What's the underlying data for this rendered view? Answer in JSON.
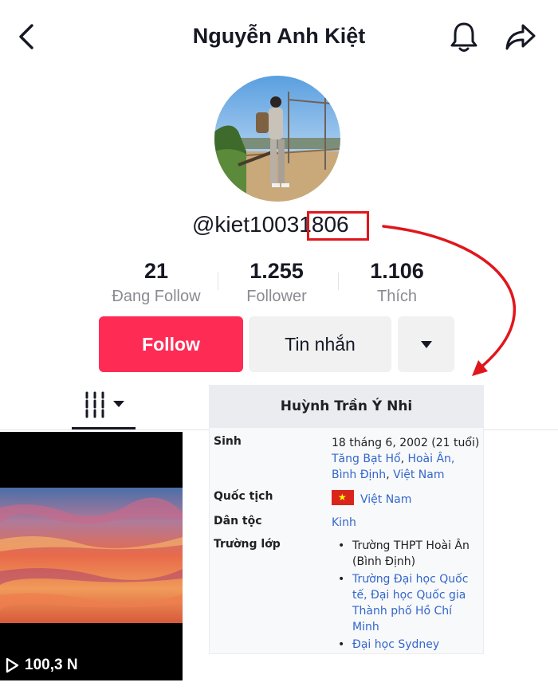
{
  "header": {
    "title": "Nguyễn Anh Kiệt",
    "back_icon": "chevron-left-icon",
    "bell_icon": "bell-icon",
    "share_icon": "share-arrow-icon"
  },
  "profile": {
    "username_prefix": "@kiet1003",
    "username_highlight": "1806",
    "stats": [
      {
        "value": "21",
        "label": "Đang Follow"
      },
      {
        "value": "1.255",
        "label": "Follower"
      },
      {
        "value": "1.106",
        "label": "Thích"
      }
    ]
  },
  "actions": {
    "follow_label": "Follow",
    "message_label": "Tin nhắn"
  },
  "video": {
    "views": "100,3 N"
  },
  "wiki": {
    "name": "Huỳnh Trần Ý Nhi",
    "birth_key": "Sinh",
    "birth_text": "18 tháng 6, 2002 (21 tuổi)",
    "birth_place_1": "Tăng Bạt Hổ",
    "birth_place_2": "Hoài Ân,",
    "birth_place_3": "Bình Định",
    "birth_place_4": "Việt Nam",
    "nationality_key": "Quốc tịch",
    "nationality_value": "Việt Nam",
    "ethnicity_key": "Dân tộc",
    "ethnicity_value": "Kinh",
    "school_key": "Trường lớp",
    "schools": [
      "Trường THPT Hoài Ân (Bình Định)",
      "Trường Đại học Quốc tế, Đại học Quốc gia Thành phố Hồ Chí Minh",
      "Đại học Sydney"
    ]
  },
  "colors": {
    "follow": "#fe2c55",
    "annotation": "#e0161c",
    "wiki_link": "#3366cc"
  }
}
